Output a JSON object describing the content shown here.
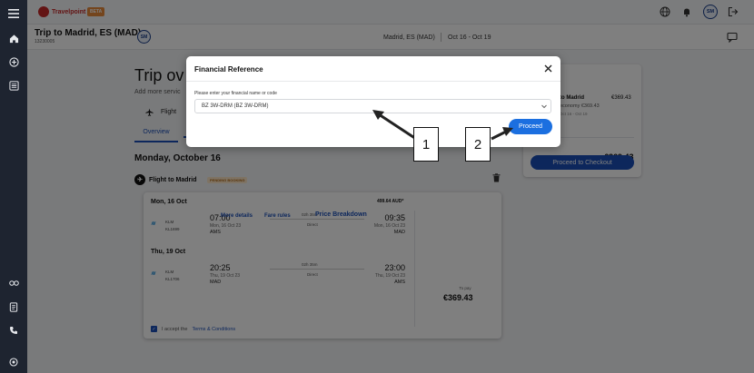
{
  "app": {
    "logo_text": "Travelpoint",
    "beta_label": "BETA",
    "avatar_initials": "SM"
  },
  "trip": {
    "title": "Trip to Madrid, ES (MAD)",
    "id": "13230005",
    "avatar_initials": "SM",
    "destination": "Madrid, ES (MAD)",
    "dates": "Oct 16 - Oct 19"
  },
  "page": {
    "heading": "Trip ov",
    "subheading": "Add more servic",
    "flight_button": "Flight",
    "tab_overview": "Overview",
    "date_heading": "Monday, October 16",
    "flight_title": "Flight to Madrid",
    "pending_badge": "PENDING BOOKING",
    "price_top": "499.64 AUD*",
    "to_pay_label": "To pay",
    "to_pay_value": "€369.43",
    "more_details": "More details",
    "fare_rules": "Fare rules",
    "price_breakdown": "Price Breakdown",
    "accept_prefix": "I accept the",
    "accept_link": "Terms & Conditions"
  },
  "segments": [
    {
      "date": "Mon, 16 Oct",
      "airline": "KLM",
      "flight_no": "KL1699",
      "dep_time": "07:00",
      "dep_date": "Mon, 16 Oct 23",
      "dep_airport": "AMS",
      "duration": "02h 35m",
      "stops": "Direct",
      "arr_time": "09:35",
      "arr_date": "Mon, 16 Oct 23",
      "arr_airport": "MAD"
    },
    {
      "date": "Thu, 19 Oct",
      "airline": "KLM",
      "flight_no": "KL1706",
      "dep_time": "20:25",
      "dep_date": "Thu, 19 Oct 23",
      "dep_airport": "MAD",
      "duration": "02h 35m",
      "stops": "Direct",
      "arr_time": "23:00",
      "arr_date": "Thu, 19 Oct 23",
      "arr_airport": "AMS"
    }
  ],
  "summary": {
    "item_title": "to Madrid",
    "item_price": "€369.43",
    "item_cabin": "economy €369.43",
    "item_dates": "Oct 16 - Oct 19",
    "total": "€369.43",
    "checkout_label": "Proceed to Checkout"
  },
  "modal": {
    "title": "Financial Reference",
    "label": "Please enter your financial name or code",
    "select_value": "BZ 3W-DRM (BZ 3W-DRM)",
    "proceed_label": "Proceed"
  },
  "callouts": [
    {
      "label": "1"
    },
    {
      "label": "2"
    }
  ],
  "colors": {
    "primary": "#1b4fb8",
    "proceed": "#1b6fe0",
    "rail": "#1e2430",
    "brand": "#c62828"
  }
}
